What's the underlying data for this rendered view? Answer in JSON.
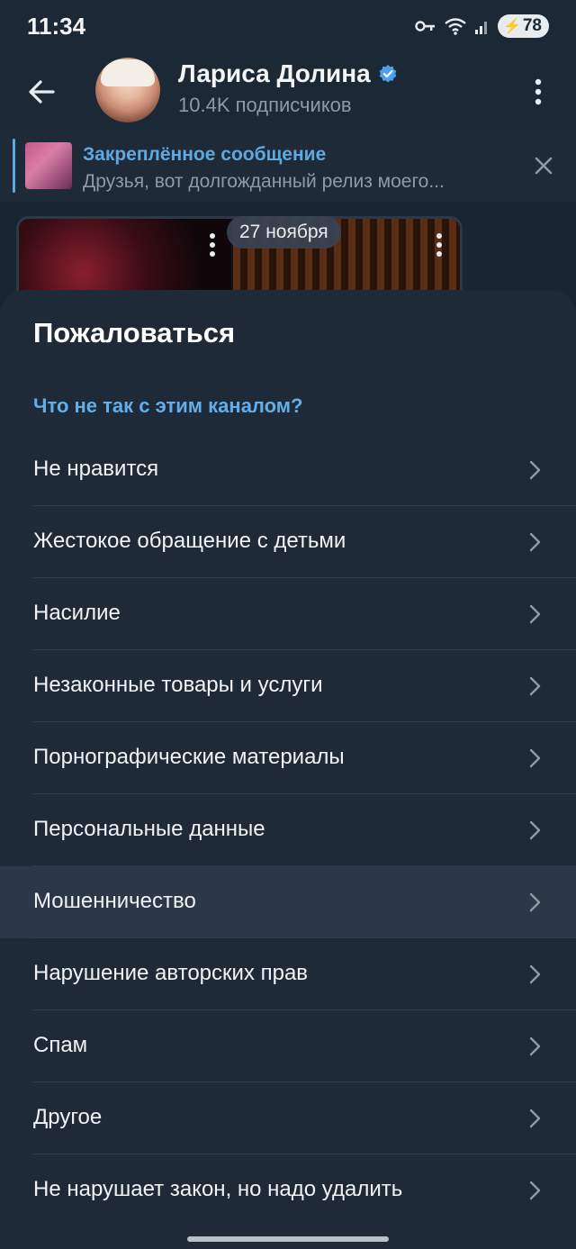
{
  "status_bar": {
    "time": "11:34",
    "battery": "78",
    "icons": [
      "key-icon",
      "wifi-icon",
      "signal-icon",
      "battery-icon"
    ]
  },
  "header": {
    "channel_name": "Лариса Долина",
    "subscribers": "10.4K подписчиков",
    "icons": [
      "back-arrow-icon",
      "verified-icon",
      "more-vertical-icon"
    ]
  },
  "pinned": {
    "title": "Закреплённое сообщение",
    "text": "Друзья, вот долгожданный релиз моего..."
  },
  "chat": {
    "date": "27 ноября"
  },
  "report_sheet": {
    "title": "Пожаловаться",
    "subtitle": "Что не так с этим каналом?",
    "options": [
      {
        "label": "Не нравится"
      },
      {
        "label": "Жестокое обращение с детьми"
      },
      {
        "label": "Насилие"
      },
      {
        "label": "Незаконные товары и услуги"
      },
      {
        "label": "Порнографические материалы"
      },
      {
        "label": "Персональные данные"
      },
      {
        "label": "Мошенничество"
      },
      {
        "label": "Нарушение авторских прав"
      },
      {
        "label": "Спам"
      },
      {
        "label": "Другое"
      },
      {
        "label": "Не нарушает закон, но надо удалить"
      }
    ]
  },
  "colors": {
    "accent": "#62aee8",
    "sheet_bg": "#1e2a38",
    "highlight_bg": "#2a3848"
  }
}
